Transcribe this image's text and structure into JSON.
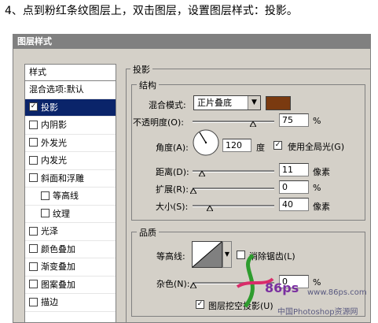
{
  "caption": "4、点到粉红条纹图层上，双击图层，设置图层样式：投影。",
  "dialog": {
    "title": "图层样式",
    "styles_header": "样式",
    "styles": [
      {
        "label": "混合选项:默认",
        "checkbox": false,
        "active": false,
        "indent": false
      },
      {
        "label": "投影",
        "checkbox": true,
        "checked": true,
        "active": true,
        "indent": false
      },
      {
        "label": "内阴影",
        "checkbox": true,
        "checked": false,
        "active": false,
        "indent": false
      },
      {
        "label": "外发光",
        "checkbox": true,
        "checked": false,
        "active": false,
        "indent": false
      },
      {
        "label": "内发光",
        "checkbox": true,
        "checked": false,
        "active": false,
        "indent": false
      },
      {
        "label": "斜面和浮雕",
        "checkbox": true,
        "checked": false,
        "active": false,
        "indent": false
      },
      {
        "label": "等高线",
        "checkbox": true,
        "checked": false,
        "active": false,
        "indent": true
      },
      {
        "label": "纹理",
        "checkbox": true,
        "checked": false,
        "active": false,
        "indent": true
      },
      {
        "label": "光泽",
        "checkbox": true,
        "checked": false,
        "active": false,
        "indent": false
      },
      {
        "label": "颜色叠加",
        "checkbox": true,
        "checked": false,
        "active": false,
        "indent": false
      },
      {
        "label": "渐变叠加",
        "checkbox": true,
        "checked": false,
        "active": false,
        "indent": false
      },
      {
        "label": "图案叠加",
        "checkbox": true,
        "checked": false,
        "active": false,
        "indent": false
      },
      {
        "label": "描边",
        "checkbox": true,
        "checked": false,
        "active": false,
        "indent": false
      }
    ],
    "drop_shadow": {
      "title": "投影",
      "structure": {
        "title": "结构",
        "blend_mode_label": "混合模式:",
        "blend_mode_value": "正片叠底",
        "shadow_color": "#7a3a10",
        "opacity_label": "不透明度(O):",
        "opacity_value": "75",
        "opacity_unit": "%",
        "angle_label": "角度(A):",
        "angle_value": "120",
        "angle_unit": "度",
        "global_light_label": "使用全局光(G)",
        "global_light_checked": true,
        "distance_label": "距离(D):",
        "distance_value": "11",
        "distance_unit": "像素",
        "spread_label": "扩展(R):",
        "spread_value": "0",
        "spread_unit": "%",
        "size_label": "大小(S):",
        "size_value": "40",
        "size_unit": "像素"
      },
      "quality": {
        "title": "品质",
        "contour_label": "等高线:",
        "antialias_label": "消除锯齿(L)",
        "antialias_checked": false,
        "noise_label": "杂色(N):",
        "noise_value": "0",
        "noise_unit": "%"
      },
      "knockout_label": "图层挖空投影(U)",
      "knockout_checked": true
    }
  },
  "watermark": {
    "site": "www.86ps.com",
    "brand": "86ps",
    "text": "中国Photoshop资源网"
  }
}
